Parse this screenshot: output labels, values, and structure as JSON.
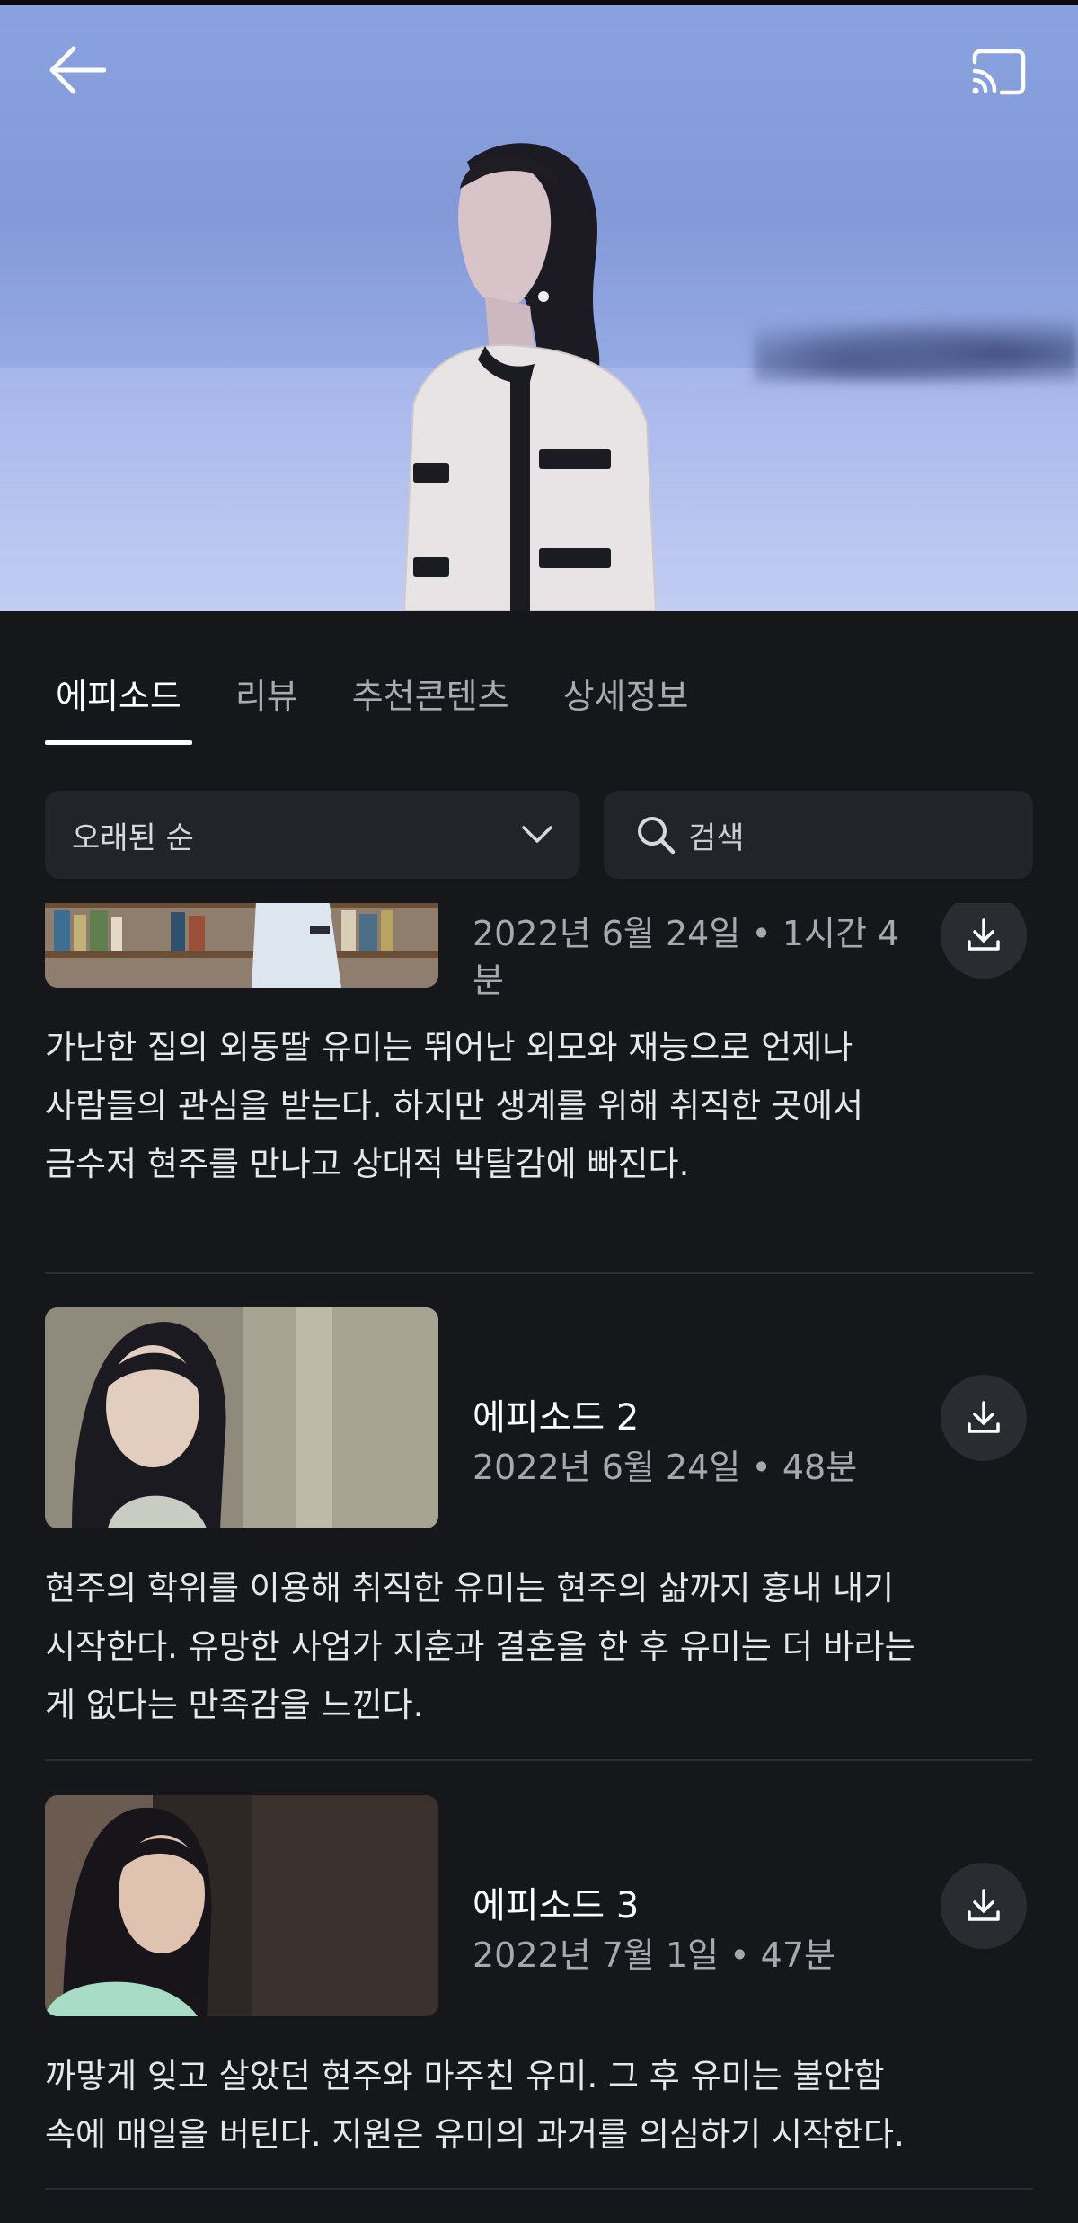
{
  "header": {
    "back_icon": "arrow-left-icon",
    "cast_icon": "cast-icon"
  },
  "tabs": [
    {
      "label": "에피소드",
      "active": true
    },
    {
      "label": "리뷰",
      "active": false
    },
    {
      "label": "추천콘텐츠",
      "active": false
    },
    {
      "label": "상세정보",
      "active": false
    }
  ],
  "filters": {
    "sort_label": "오래된 순",
    "search_placeholder": "검색"
  },
  "episodes": [
    {
      "title": "",
      "meta": "2022년 6월 24일 • 1시간 4분",
      "description": "가난한 집의 외동딸 유미는 뛰어난 외모와 재능으로 언제나\n사람들의 관심을 받는다. 하지만 생계를 위해 취직한 곳에서\n금수저 현주를 만나고 상대적 박탈감에 빠진다."
    },
    {
      "title": "에피소드 2",
      "meta": "2022년 6월 24일 • 48분",
      "description": "현주의 학위를 이용해 취직한 유미는 현주의 삶까지 흉내 내기\n시작한다. 유망한 사업가 지훈과 결혼을 한 후 유미는 더 바라는\n게 없다는 만족감을 느낀다."
    },
    {
      "title": "에피소드 3",
      "meta": "2022년 7월 1일 • 47분",
      "description": "까맣게 잊고 살았던 현주와 마주친 유미. 그 후 유미는 불안함\n속에 매일을 버틴다. 지원은 유미의 과거를 의심하기 시작한다."
    }
  ],
  "colors": {
    "background": "#16171b",
    "surface": "#22242a",
    "text_primary": "#ffffff",
    "text_secondary": "#a7a9b0"
  }
}
